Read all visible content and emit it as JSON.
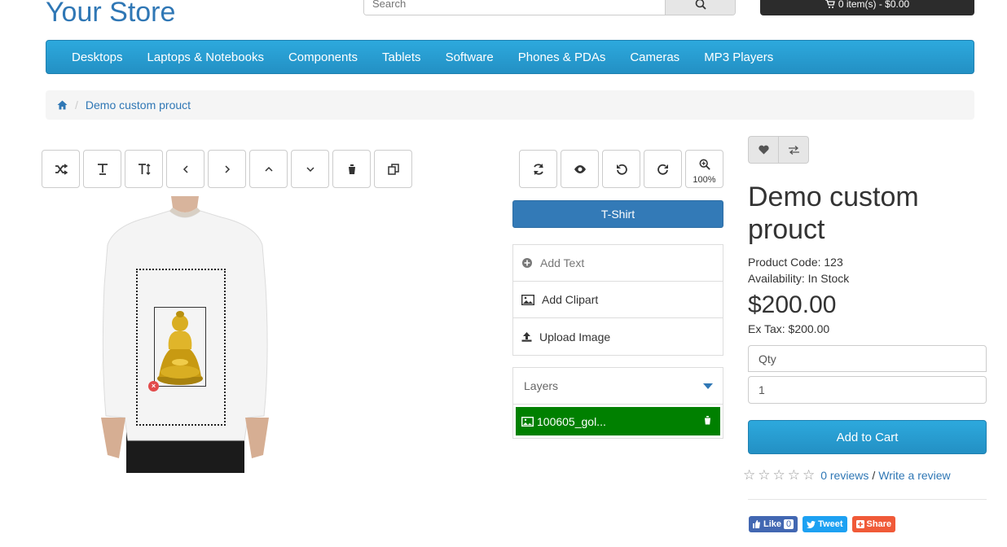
{
  "header": {
    "store_name": "Your Store",
    "search_placeholder": "Search",
    "cart_label": "0 item(s) - $0.00"
  },
  "nav": {
    "items": [
      "Desktops",
      "Laptops & Notebooks",
      "Components",
      "Tablets",
      "Software",
      "Phones & PDAs",
      "Cameras",
      "MP3 Players"
    ]
  },
  "breadcrumb": {
    "current": "Demo custom prouct"
  },
  "designer": {
    "toolbar_left": [
      "shuffle-icon",
      "text-icon",
      "text-size-icon",
      "chevron-left-icon",
      "chevron-right-icon",
      "chevron-up-icon",
      "chevron-down-icon",
      "trash-icon",
      "copy-icon"
    ],
    "toolbar_right": [
      "refresh-icon",
      "eye-icon",
      "undo-icon",
      "redo-icon",
      "zoom-in-icon"
    ],
    "zoom_level": "100%",
    "product_view": "T-Shirt",
    "tools": {
      "add_text": "Add Text",
      "add_clipart": "Add Clipart",
      "upload_image": "Upload Image"
    },
    "layers": {
      "title": "Layers",
      "items": [
        {
          "name": "100605_gol..."
        }
      ]
    },
    "colors": {
      "accent": "#337ab7",
      "layer_active": "#008000"
    }
  },
  "product": {
    "title": "Demo custom prouct",
    "code_label": "Product Code: 123",
    "availability_label": "Availability: In Stock",
    "price": "$200.00",
    "ex_tax": "Ex Tax: $200.00",
    "qty_label": "Qty",
    "qty_value": "1",
    "add_to_cart": "Add to Cart",
    "rating": 0,
    "reviews_link": "0 reviews",
    "review_sep": "/",
    "write_review": "Write a review",
    "share": {
      "like": "Like",
      "like_count": "0",
      "tweet": "Tweet",
      "share": "Share"
    }
  }
}
